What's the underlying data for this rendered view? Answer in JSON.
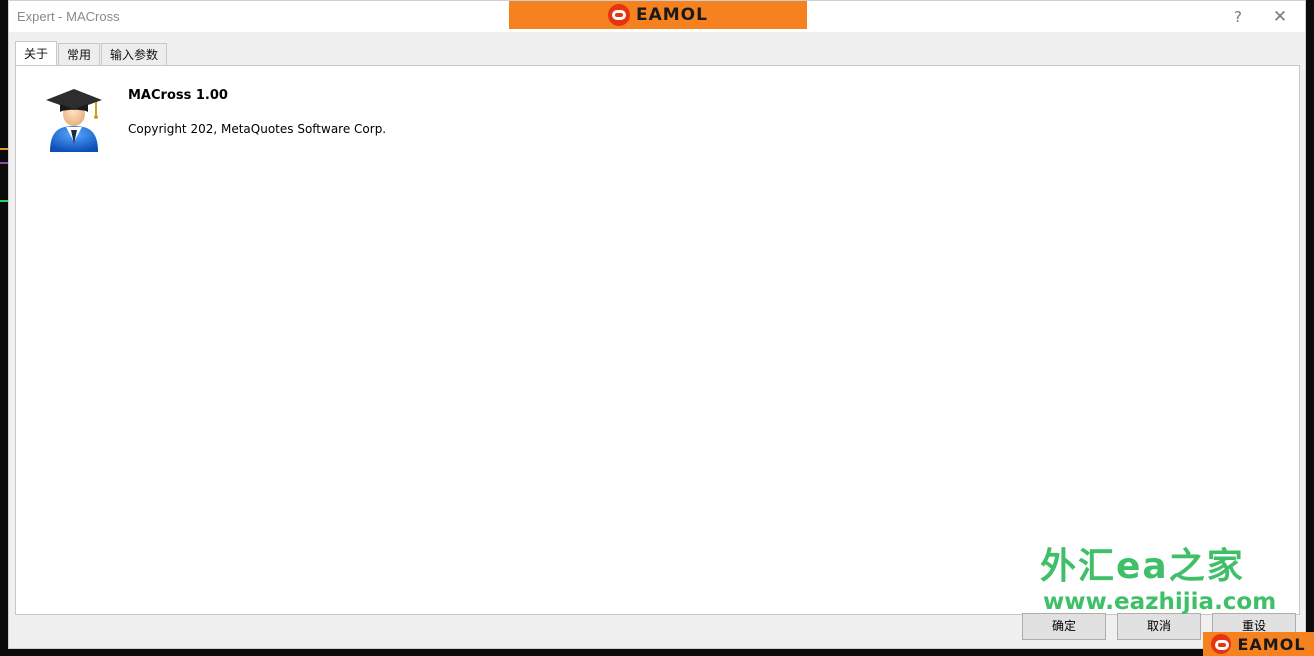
{
  "window": {
    "title": "Expert - MACross",
    "help_glyph": "?",
    "close_glyph": "✕"
  },
  "brand": {
    "banner_text": "EAMOL",
    "corner_text": "EAMOL",
    "color": "#f5821f"
  },
  "tabs": [
    {
      "label": "关于",
      "active": true
    },
    {
      "label": "常用",
      "active": false
    },
    {
      "label": "输入参数",
      "active": false
    }
  ],
  "about": {
    "icon": "graduate-avatar-icon",
    "name": "MACross 1.00",
    "copyright": "Copyright 202, MetaQuotes Software Corp."
  },
  "watermark": {
    "title": "外汇ea之家",
    "url": "www.eazhijia.com",
    "color": "#3fbf67"
  },
  "buttons": {
    "ok": "确定",
    "cancel": "取消",
    "reset": "重设"
  }
}
